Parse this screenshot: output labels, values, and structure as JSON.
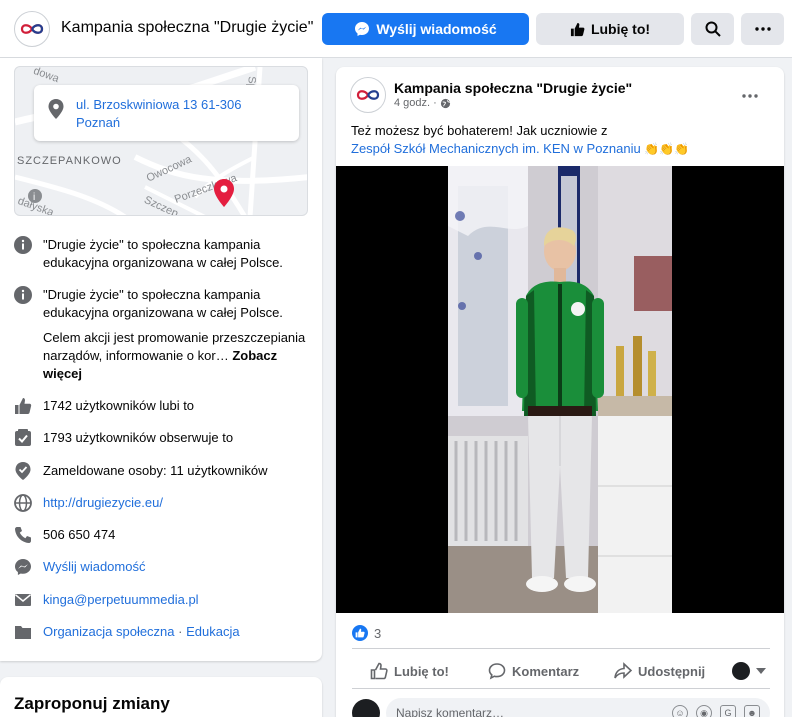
{
  "header": {
    "page_name": "Kampania społeczna \"Drugie życie\"",
    "send_message_label": "Wyślij wiadomość",
    "like_label": "Lubię to!",
    "search_icon": "search-icon",
    "more_icon": "more-icon"
  },
  "map": {
    "street_labels": [
      "dowa",
      "SZCZEPANKOWO",
      "Owocowa",
      "Porzeczkowa",
      "Szczep",
      "dałyska",
      "Sp"
    ],
    "address_line1": "ul. Brzoskwiniowa 13 61-306",
    "address_line2": "Poznań",
    "pin_color": "#e41e3f"
  },
  "about": {
    "desc1": "\"Drugie życie\" to społeczna kampania edukacyjna organizowana w całej Polsce.",
    "desc2": "\"Drugie życie\" to społeczna kampania edukacyjna organizowana w całej Polsce.",
    "desc3": "Celem akcji jest promowanie przeszczepiania narządów, informowanie o kor…",
    "see_more": "Zobacz więcej",
    "likes": "1742 użytkowników lubi to",
    "follows": "1793 użytkowników obserwuje to",
    "checkins": "Zameldowane osoby: 11 użytkowników",
    "website": "http://drugiezycie.eu/",
    "phone": "506 650 474",
    "message": "Wyślij wiadomość",
    "email": "kinga@perpetuummedia.pl",
    "category1": "Organizacja społeczna",
    "category_sep": " · ",
    "category2": "Edukacja"
  },
  "suggest": {
    "title": "Zaproponuj zmiany"
  },
  "post": {
    "author": "Kampania społeczna \"Drugie życie\"",
    "time": "4 godz. ·",
    "text_line1": "Też możesz być bohaterem! Jak uczniowie z",
    "text_link": "Zespół Szkół Mechanicznych im. KEN w Poznaniu",
    "emojis": "👏👏👏",
    "reaction_count": "3",
    "like_action": "Lubię to!",
    "comment_action": "Komentarz",
    "share_action": "Udostępnij",
    "comment_placeholder": "Napisz komentarz…",
    "accent_color": "#1877f2"
  }
}
